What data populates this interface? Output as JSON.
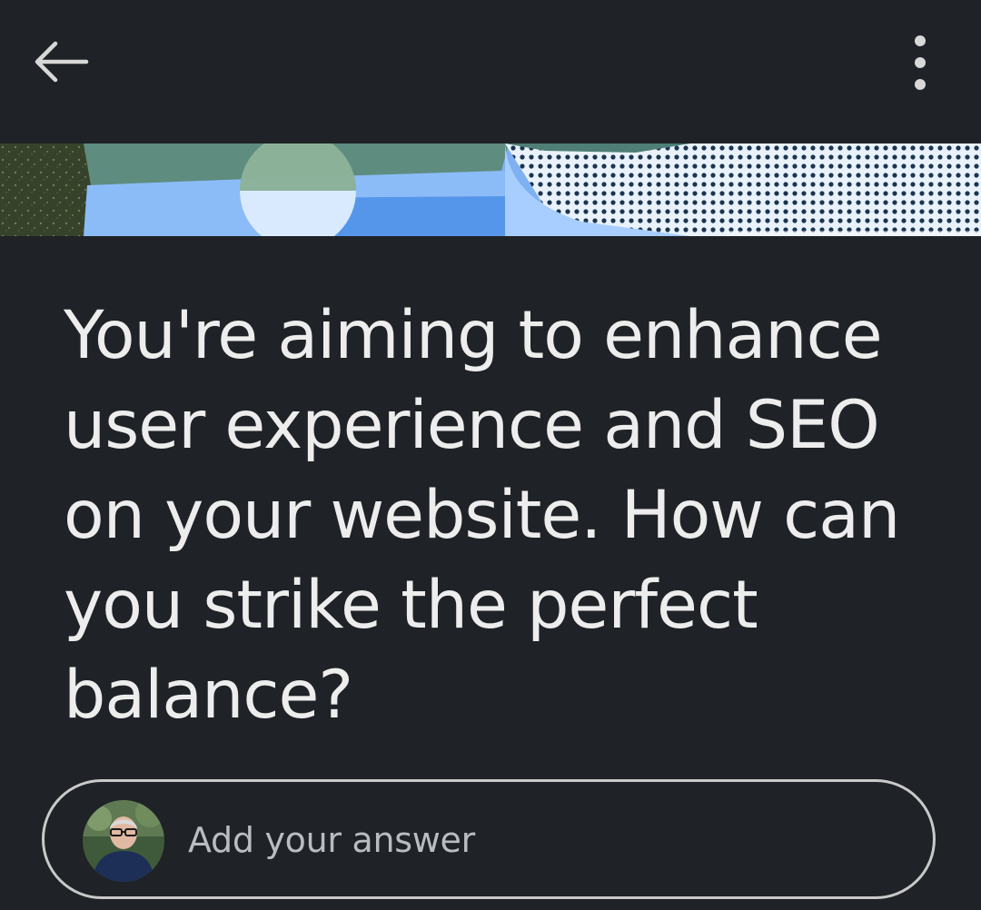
{
  "header": {
    "back_icon": "arrow-left-icon",
    "more_icon": "vertical-dots-icon"
  },
  "banner": {
    "colors": [
      "#3b4a2e",
      "#5c8b7d",
      "#4f8fe6",
      "#a9d0ff",
      "#ffffff"
    ]
  },
  "question": {
    "text": "You're aiming to enhance user experience and SEO on your website. How can you strike the perfect balance?"
  },
  "answer": {
    "placeholder": "Add your answer",
    "avatar_icon": "user-avatar"
  },
  "colors": {
    "background": "#1f2226",
    "text": "#ededed",
    "placeholder": "#b9bcc0",
    "border": "#c9c9c9"
  }
}
